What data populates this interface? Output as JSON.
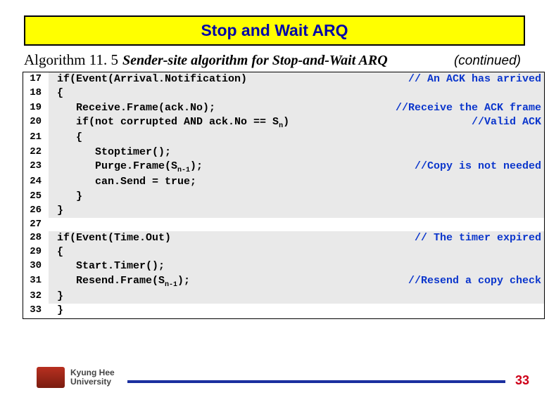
{
  "title": "Stop and Wait ARQ",
  "algo_label": "Algorithm 11. 5",
  "algo_caption": "Sender-site algorithm for Stop-and-Wait ARQ",
  "continued": "(continued)",
  "code": {
    "lines": [
      {
        "n": "17",
        "band": "grey",
        "text": "if(Event(Arrival.Notification)",
        "comment": "// An ACK has arrived"
      },
      {
        "n": "18",
        "band": "grey",
        "text": "{",
        "comment": ""
      },
      {
        "n": "19",
        "band": "grey",
        "text": "   Receive.Frame(ack.No);",
        "comment": "//Receive the ACK frame"
      },
      {
        "n": "20",
        "band": "grey",
        "text_html": "   if(not corrupted AND ack.No == S<span class='sub'>n</span>)",
        "comment": "//Valid ACK"
      },
      {
        "n": "21",
        "band": "grey",
        "text": "   {",
        "comment": ""
      },
      {
        "n": "22",
        "band": "grey",
        "text": "      Stoptimer();",
        "comment": ""
      },
      {
        "n": "23",
        "band": "grey",
        "text_html": "      Purge.Frame(S<span class='sub'>n-1</span>);",
        "comment": "//Copy is not needed"
      },
      {
        "n": "24",
        "band": "grey",
        "text": "      can.Send = true;",
        "comment": ""
      },
      {
        "n": "25",
        "band": "grey",
        "text": "   }",
        "comment": ""
      },
      {
        "n": "26",
        "band": "grey",
        "text": "}",
        "comment": ""
      },
      {
        "n": "27",
        "band": "white",
        "text": "",
        "comment": ""
      },
      {
        "n": "28",
        "band": "grey",
        "text": "if(Event(Time.Out)",
        "comment": "// The timer expired"
      },
      {
        "n": "29",
        "band": "grey",
        "text": "{",
        "comment": ""
      },
      {
        "n": "30",
        "band": "grey",
        "text": "   Start.Timer();",
        "comment": ""
      },
      {
        "n": "31",
        "band": "grey",
        "text_html": "   Resend.Frame(S<span class='sub'>n-1</span>);",
        "comment": "//Resend a copy check"
      },
      {
        "n": "32",
        "band": "grey",
        "text": "}",
        "comment": ""
      },
      {
        "n": "33",
        "band": "white",
        "text": "}",
        "comment": ""
      }
    ]
  },
  "footer": {
    "uni_line1": "Kyung Hee",
    "uni_line2": "University",
    "page": "33"
  }
}
